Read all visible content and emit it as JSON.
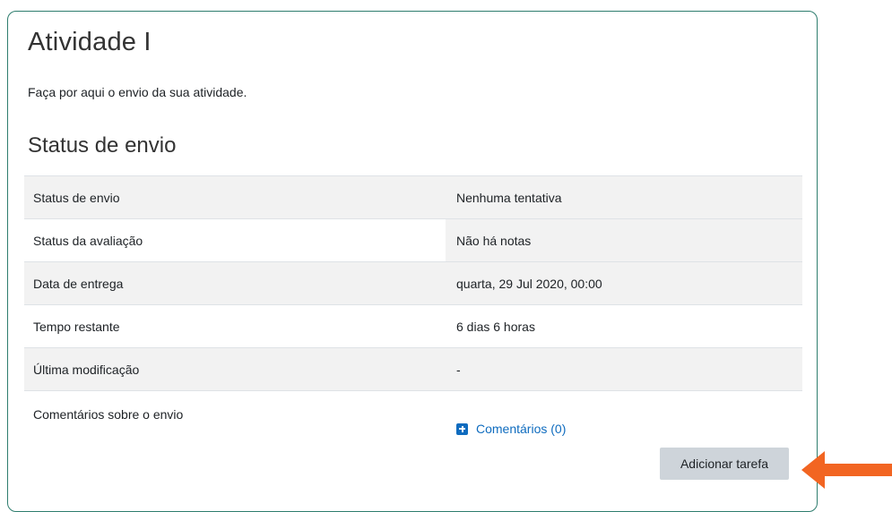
{
  "page": {
    "title": "Atividade I",
    "description": "Faça por aqui o envio da sua atividade.",
    "section_title": "Status de envio"
  },
  "status_table": {
    "rows": [
      {
        "label": "Status de envio",
        "value": "Nenhuma tentativa"
      },
      {
        "label": "Status da avaliação",
        "value": "Não há notas"
      },
      {
        "label": "Data de entrega",
        "value": "quarta, 29 Jul 2020, 00:00"
      },
      {
        "label": "Tempo restante",
        "value": "6 dias 6 horas"
      },
      {
        "label": "Última modificação",
        "value": "-"
      },
      {
        "label": "Comentários sobre o envio",
        "link": "Comentários (0)",
        "icon": "plus-square-icon"
      }
    ]
  },
  "actions": {
    "add_submission": "Adicionar tarefa"
  },
  "colors": {
    "card_border": "#2e7d6e",
    "link": "#0f6cbf",
    "button_bg": "#ced4da",
    "row_shade": "#f2f2f2",
    "arrow": "#f26522"
  }
}
